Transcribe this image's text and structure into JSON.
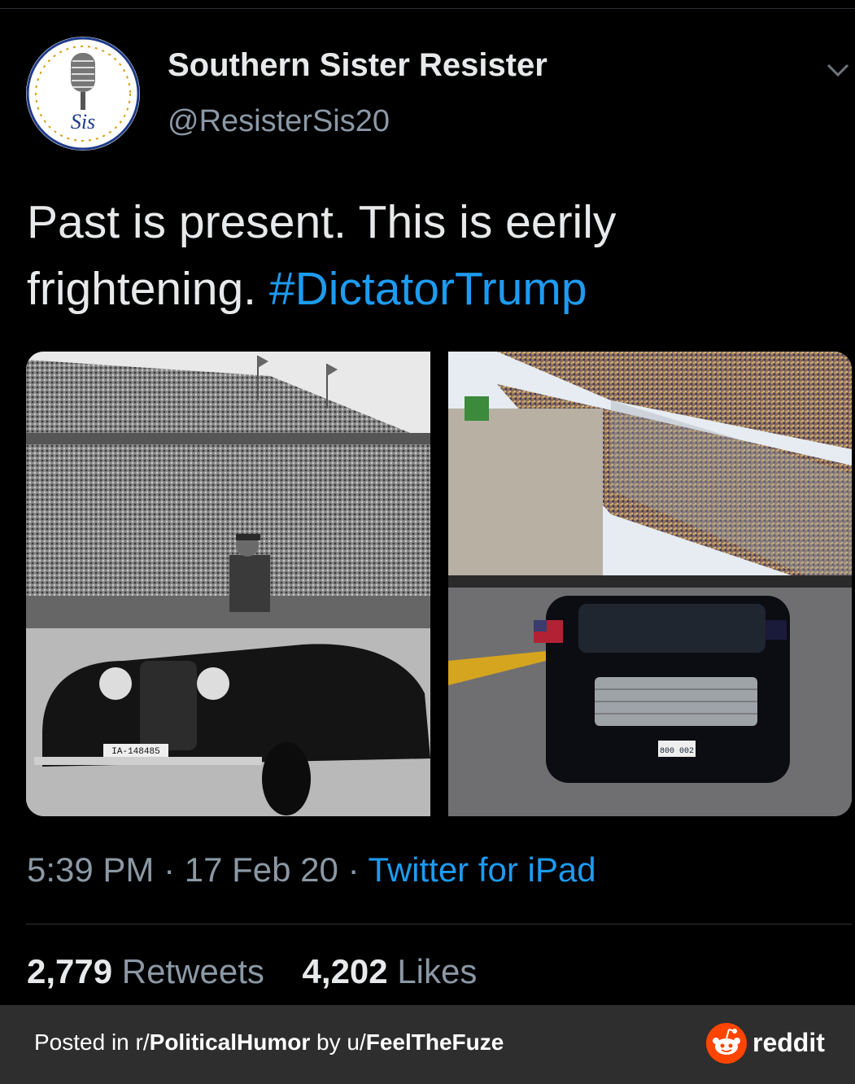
{
  "tweet": {
    "display_name": "Southern Sister Resister",
    "handle": "@ResisterSis20",
    "avatar_text": "Sis",
    "text": "Past is present. This is eerily frightening.",
    "hashtag": "#DictatorTrump",
    "time": "5:39 PM",
    "date": "17 Feb 20",
    "source": "Twitter for iPad",
    "separator": " · ",
    "retweets_count": "2,779",
    "retweets_label": "Retweets",
    "likes_count": "4,202",
    "likes_label": "Likes",
    "images": [
      {
        "description_icon": "historical-stadium-photo",
        "plate": "IA-148485"
      },
      {
        "description_icon": "speedway-motorcade-photo",
        "plate": "800 002"
      }
    ]
  },
  "footer": {
    "posted_in_prefix": "Posted in r/",
    "subreddit": "PoliticalHumor",
    "by_prefix": " by u/",
    "username": "FeelTheFuze",
    "brand": "reddit",
    "brand_color": "#ff4500"
  },
  "colors": {
    "background": "#000000",
    "text": "#e7e9ea",
    "muted": "#8b98a5",
    "link": "#1d9bf0",
    "footer_bg": "#2e2e2e"
  }
}
